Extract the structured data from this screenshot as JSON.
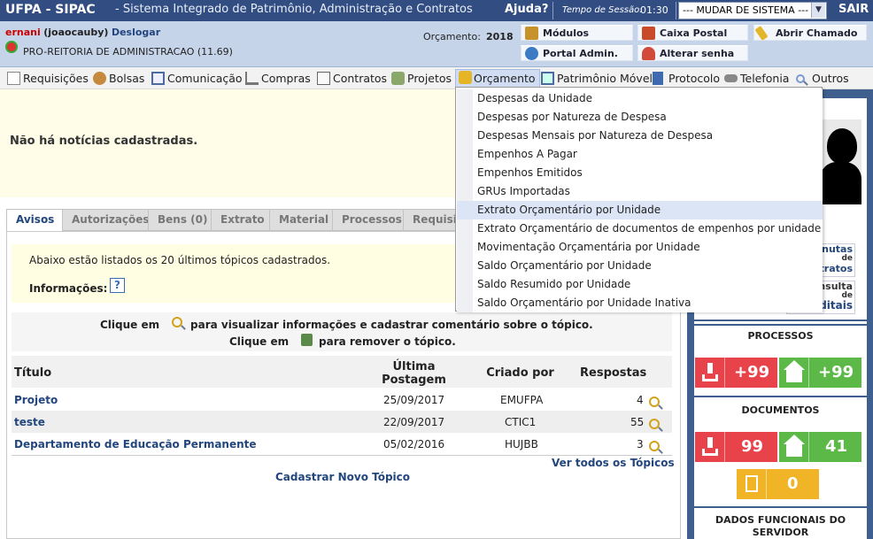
{
  "topbar": {
    "app_name": "UFPA - SIPAC",
    "app_title": "- Sistema Integrado de Patrimônio, Administração e Contratos",
    "help": "Ajuda?",
    "session_label": "Tempo de Sessão:",
    "session_time": "01:30",
    "system_select": "--- MUDAR DE SISTEMA ---",
    "logout": "SAIR"
  },
  "user": {
    "login": "ernani",
    "name": "(joaocauby)",
    "logout_link": "Deslogar",
    "unit": "PRO-REITORIA DE ADMINISTRACAO (11.69)",
    "budget_label": "Orçamento:",
    "budget_year": "2018"
  },
  "quick_links": {
    "modulos": "Módulos",
    "caixa_postal": "Caixa Postal",
    "abrir_chamado": "Abrir Chamado",
    "portal_admin": "Portal Admin.",
    "alterar_senha": "Alterar senha"
  },
  "menu": {
    "requisicoes": "Requisições",
    "bolsas": "Bolsas",
    "comunicacao": "Comunicação",
    "compras": "Compras",
    "contratos": "Contratos",
    "projetos": "Projetos",
    "orcamento": "Orçamento",
    "patrimonio": "Patrimônio Móvel",
    "protocolo": "Protocolo",
    "telefonia": "Telefonia",
    "outros": "Outros"
  },
  "dropdown": [
    "Despesas da Unidade",
    "Despesas por Natureza de Despesa",
    "Despesas Mensais por Natureza de Despesa",
    "Empenhos A Pagar",
    "Empenhos Emitidos",
    "GRUs Importadas",
    "Extrato Orçamentário por Unidade",
    "Extrato Orçamentário de documentos de empenhos por unidade",
    "Movimentação Orçamentária por Unidade",
    "Saldo Orçamentário por Unidade",
    "Saldo Resumido por Unidade",
    "Saldo Orçamentário por Unidade Inativa"
  ],
  "news": {
    "empty_message": "Não há notícias cadastradas."
  },
  "tabs": [
    "Avisos",
    "Autorizações",
    "Bens (0)",
    "Extrato",
    "Material",
    "Processos",
    "Requisiç"
  ],
  "avisos": {
    "intro": "Abaixo estão listados os 20 últimos tópicos cadastrados.",
    "info_label": "Informações:",
    "info_icon": "?",
    "click_prefix": "Clique em",
    "click_view": "para visualizar informações e cadastrar comentário sobre o tópico.",
    "click_remove": "para remover o tópico.",
    "headers": {
      "title": "Título",
      "last_post_1": "Última",
      "last_post_2": "Postagem",
      "created_by": "Criado por",
      "replies": "Respostas"
    },
    "rows": [
      {
        "title": "Projeto",
        "date": "25/09/2017",
        "author": "EMUFPA",
        "replies": "4"
      },
      {
        "title": "teste",
        "date": "22/09/2017",
        "author": "CTIC1",
        "replies": "55"
      },
      {
        "title": "Departamento de Educação Permanente",
        "date": "05/02/2016",
        "author": "HUJBB",
        "replies": "3"
      }
    ],
    "see_all": "Ver todos os Tópicos",
    "new_topic": "Cadastrar Novo Tópico"
  },
  "sidebar": {
    "minutas_1": "nutas",
    "minutas_2": "de",
    "minutas_3": "ntratos",
    "consulta_1": "nsulta",
    "consulta_2": "de",
    "consulta_3": "ditais",
    "processos_title": "PROCESSOS",
    "processos_in": "+99",
    "processos_home": "+99",
    "documentos_title": "DOCUMENTOS",
    "documentos_in": "99",
    "documentos_home": "41",
    "documentos_pending": "0",
    "dados_title_1": "DADOS FUNCIONAIS DO",
    "dados_title_2": "SERVIDOR"
  },
  "colors": {
    "header": "#324d82",
    "red_card": "#e8434a",
    "green_card": "#5cb947",
    "yellow_card": "#f1b427"
  }
}
